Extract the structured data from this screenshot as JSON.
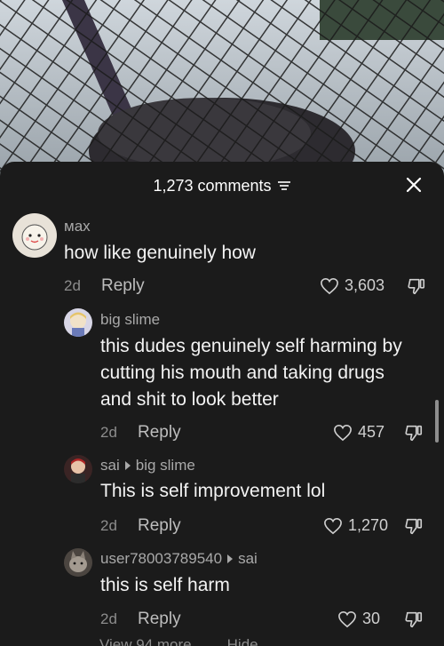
{
  "header": {
    "comments_count": "1,273 comments",
    "filter_icon": "filter-icon",
    "close_icon": "close-icon"
  },
  "comments": [
    {
      "username": "мах",
      "text": "how like genuinely how",
      "date": "2d",
      "reply_label": "Reply",
      "likes": "3,603"
    },
    {
      "username": "big slime",
      "text": "this dudes genuinely self harming by cutting his mouth and taking drugs and shit to look better",
      "date": "2d",
      "reply_label": "Reply",
      "likes": "457"
    },
    {
      "username": "sai",
      "reply_to": "big slime",
      "text": "This is self improvement lol",
      "date": "2d",
      "reply_label": "Reply",
      "likes": "1,270"
    },
    {
      "username": "user78003789540",
      "reply_to": "sai",
      "text": "this is self harm",
      "date": "2d",
      "reply_label": "Reply",
      "likes": "30"
    }
  ],
  "footer": {
    "view_more": "View 94 more",
    "hide": "Hide"
  },
  "colors": {
    "sheet_bg": "#1b1b1b",
    "text_primary": "#f3f3f3",
    "text_secondary": "#a9a9a9"
  }
}
